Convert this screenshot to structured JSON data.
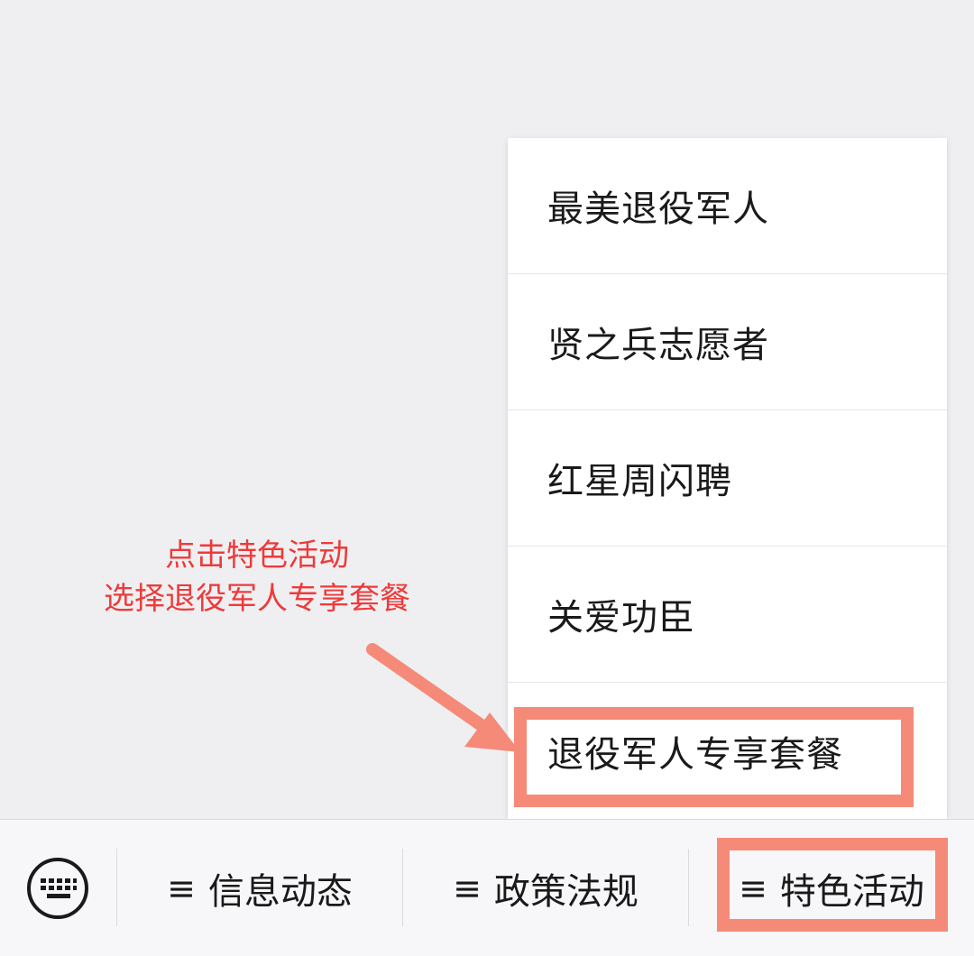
{
  "menu": {
    "items": [
      {
        "label": "最美退役军人"
      },
      {
        "label": "贤之兵志愿者"
      },
      {
        "label": "红星周闪聘"
      },
      {
        "label": "关爱功臣"
      },
      {
        "label": "退役军人专享套餐"
      }
    ]
  },
  "annotation": {
    "line1": "点击特色活动",
    "line2": "选择退役军人专享套餐"
  },
  "bottom_bar": {
    "tabs": [
      {
        "icon": "≡",
        "label": "信息动态"
      },
      {
        "icon": "≡",
        "label": "政策法规"
      },
      {
        "icon": "≡",
        "label": "特色活动"
      }
    ]
  },
  "colors": {
    "highlight": "#f58a78",
    "annotation_text": "#ee3a3a"
  }
}
